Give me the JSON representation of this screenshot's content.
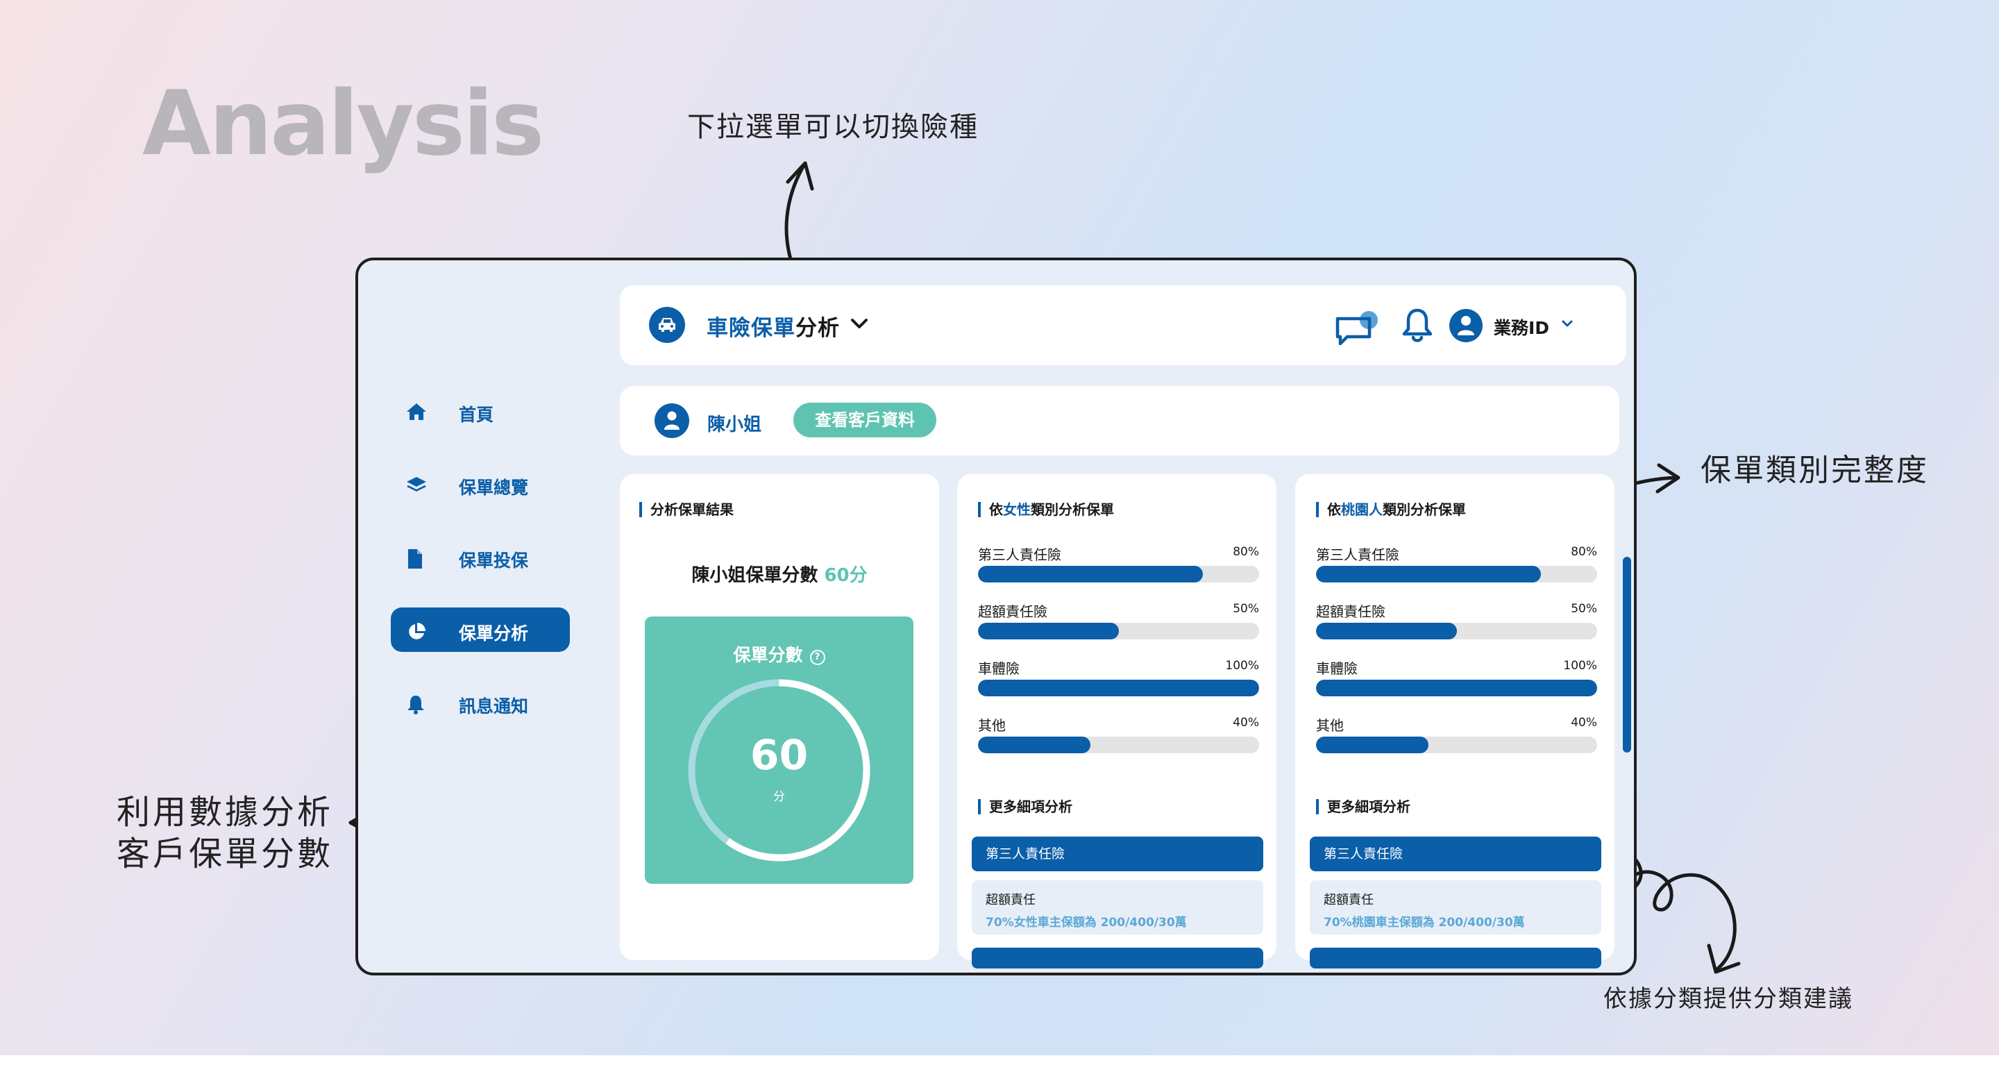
{
  "hero": {
    "title": "Analysis"
  },
  "annotations": {
    "top": "下拉選單可以切換險種",
    "right": "保單類別完整度",
    "left_line1": "利用數據分析",
    "left_line2": "客戶保單分數",
    "bottom": "依據分類提供分類建議"
  },
  "topbar": {
    "title_blue": "車險保單",
    "title_dark": "分析",
    "user_label": "業務ID"
  },
  "customer": {
    "name": "陳小姐",
    "view_button": "查看客戶資料"
  },
  "nav": [
    {
      "label": "首頁",
      "icon": "home-icon"
    },
    {
      "label": "保單總覽",
      "icon": "layers-icon"
    },
    {
      "label": "保單投保",
      "icon": "document-icon"
    },
    {
      "label": "保單分析",
      "icon": "pie-chart-icon",
      "active": true
    },
    {
      "label": "訊息通知",
      "icon": "bell-icon"
    }
  ],
  "result_panel": {
    "title": "分析保單結果",
    "score_text": "陳小姐保單分數",
    "score_value_text": "60分",
    "box_title": "保單分數",
    "score": "60",
    "unit": "分",
    "score_fraction": 0.6
  },
  "gender_panel": {
    "title_pre": "依",
    "title_hl": "女性",
    "title_post": "類別分析保單",
    "bars": [
      {
        "label": "第三人責任險",
        "percent_text": "80%",
        "value": 80
      },
      {
        "label": "超額責任險",
        "percent_text": "50%",
        "value": 50
      },
      {
        "label": "車體險",
        "percent_text": "100%",
        "value": 100
      },
      {
        "label": "其他",
        "percent_text": "40%",
        "value": 40
      }
    ],
    "more_title": "更多細項分析",
    "detail_head": "第三人責任險",
    "detail_title": "超額責任",
    "detail_desc": "70%女性車主保額為  200/400/30萬"
  },
  "region_panel": {
    "title_pre": "依",
    "title_hl": "桃園人",
    "title_post": "類別分析保單",
    "bars": [
      {
        "label": "第三人責任險",
        "percent_text": "80%",
        "value": 80
      },
      {
        "label": "超額責任險",
        "percent_text": "50%",
        "value": 50
      },
      {
        "label": "車體險",
        "percent_text": "100%",
        "value": 100
      },
      {
        "label": "其他",
        "percent_text": "40%",
        "value": 40
      }
    ],
    "more_title": "更多細項分析",
    "detail_head": "第三人責任險",
    "detail_title": "超額責任",
    "detail_desc": "70%桃園車主保額為  200/400/30萬"
  },
  "colors": {
    "primary": "#0b5ea8",
    "teal": "#5ec4b1",
    "frame_bg": "#e8eef7"
  }
}
